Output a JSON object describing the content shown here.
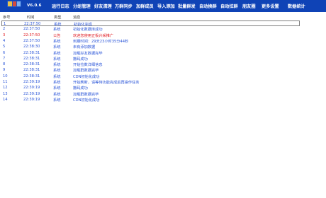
{
  "app": {
    "version": "V6.0.6",
    "colors": {
      "menubar": "#0f43b6",
      "log_blue": "#2a55d8",
      "log_red": "#e0161c",
      "menu_text": "#ffffff"
    }
  },
  "menu": {
    "items": [
      {
        "label": "运行日志"
      },
      {
        "label": "分组管理"
      },
      {
        "label": "好友清理"
      },
      {
        "label": "万群同步"
      },
      {
        "label": "加群成员"
      },
      {
        "label": "导入添加"
      },
      {
        "label": "批量群发"
      },
      {
        "label": "自动换群"
      },
      {
        "label": "自动拉群"
      },
      {
        "label": "朋友圈"
      },
      {
        "label": "更多设置"
      },
      {
        "label": "数据统计"
      }
    ]
  },
  "log_table": {
    "headers": {
      "index": "序号",
      "time": "时间",
      "type": "类型",
      "message": "消息"
    },
    "rows": [
      {
        "index": "1",
        "time": "22:37:50",
        "type": "系统",
        "message": "初始化完成",
        "level": "info"
      },
      {
        "index": "2",
        "time": "22:37:50",
        "type": "系统",
        "message": "初始化数据库成功",
        "level": "info"
      },
      {
        "index": "3",
        "time": "22:37:50",
        "type": "公告",
        "message": "欢迎您使用正板兴采推广",
        "level": "notice"
      },
      {
        "index": "4",
        "time": "22:37:50",
        "type": "系统",
        "message": "到期时间：29天23小时35分44秒",
        "level": "info"
      },
      {
        "index": "5",
        "time": "22:38:30",
        "type": "系统",
        "message": "未有添加数据",
        "level": "info"
      },
      {
        "index": "6",
        "time": "22:38:31",
        "type": "系统",
        "message": "加载好友数据完毕",
        "level": "info"
      },
      {
        "index": "7",
        "time": "22:38:31",
        "type": "系统",
        "message": "撤码成功",
        "level": "info"
      },
      {
        "index": "8",
        "time": "22:38:31",
        "type": "系统",
        "message": "开始拉数详细信息",
        "level": "info"
      },
      {
        "index": "9",
        "time": "22:38:31",
        "type": "系统",
        "message": "加载群数据完毕",
        "level": "info"
      },
      {
        "index": "10",
        "time": "22:38:31",
        "type": "系统",
        "message": "CDN初始化成功",
        "level": "info"
      },
      {
        "index": "11",
        "time": "22:39:19",
        "type": "系统",
        "message": "开始刷新，请等待功能完成后再操作任务",
        "level": "info"
      },
      {
        "index": "12",
        "time": "22:39:19",
        "type": "系统",
        "message": "撤码成功",
        "level": "info"
      },
      {
        "index": "13",
        "time": "22:39:19",
        "type": "系统",
        "message": "加载群数据完毕",
        "level": "info"
      },
      {
        "index": "14",
        "time": "22:39:19",
        "type": "系统",
        "message": "CDN初始化成功",
        "level": "info"
      }
    ]
  }
}
